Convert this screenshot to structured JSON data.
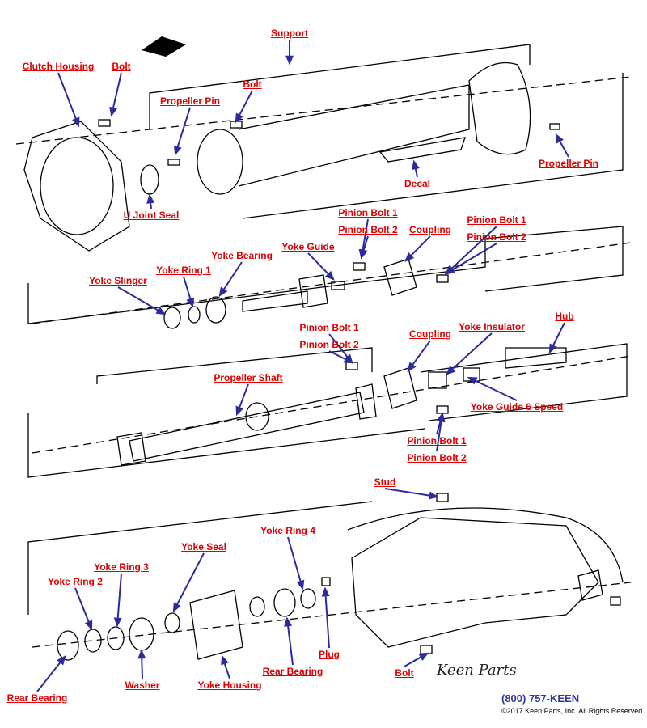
{
  "labels": [
    {
      "text": "Support"
    },
    {
      "text": "Clutch Housing"
    },
    {
      "text": "Bolt"
    },
    {
      "text": "Bolt"
    },
    {
      "text": "Propeller Pin"
    },
    {
      "text": "Propeller Pin"
    },
    {
      "text": "Decal"
    },
    {
      "text": "U Joint Seal"
    },
    {
      "text": "Pinion Bolt 1"
    },
    {
      "text": "Pinion Bolt 2"
    },
    {
      "text": "Coupling"
    },
    {
      "text": "Pinion Bolt 1"
    },
    {
      "text": "Pinion Bolt 2"
    },
    {
      "text": "Yoke Bearing"
    },
    {
      "text": "Yoke Guide"
    },
    {
      "text": "Yoke Ring 1"
    },
    {
      "text": "Yoke Slinger"
    },
    {
      "text": "Pinion Bolt 1"
    },
    {
      "text": "Pinion Bolt 2"
    },
    {
      "text": "Coupling"
    },
    {
      "text": "Yoke Insulator"
    },
    {
      "text": "Hub"
    },
    {
      "text": "Propeller Shaft"
    },
    {
      "text": "Yoke Guide 6 Speed"
    },
    {
      "text": "Pinion Bolt 1"
    },
    {
      "text": "Pinion Bolt 2"
    },
    {
      "text": "Stud"
    },
    {
      "text": "Yoke Ring 4"
    },
    {
      "text": "Yoke Seal"
    },
    {
      "text": "Yoke Ring 3"
    },
    {
      "text": "Yoke Ring 2"
    },
    {
      "text": "Plug"
    },
    {
      "text": "Rear Bearing"
    },
    {
      "text": "Bolt"
    },
    {
      "text": "Washer"
    },
    {
      "text": "Yoke Housing"
    },
    {
      "text": "Rear Bearing"
    }
  ],
  "footer": {
    "logo_text": "Keen Parts",
    "phone": "(800) 757-KEEN",
    "copyright": "©2017 Keen Parts, Inc. All Rights Reserved"
  },
  "colors": {
    "label": "#e00000",
    "arrow": "#2b2b9c",
    "line": "#000000"
  }
}
